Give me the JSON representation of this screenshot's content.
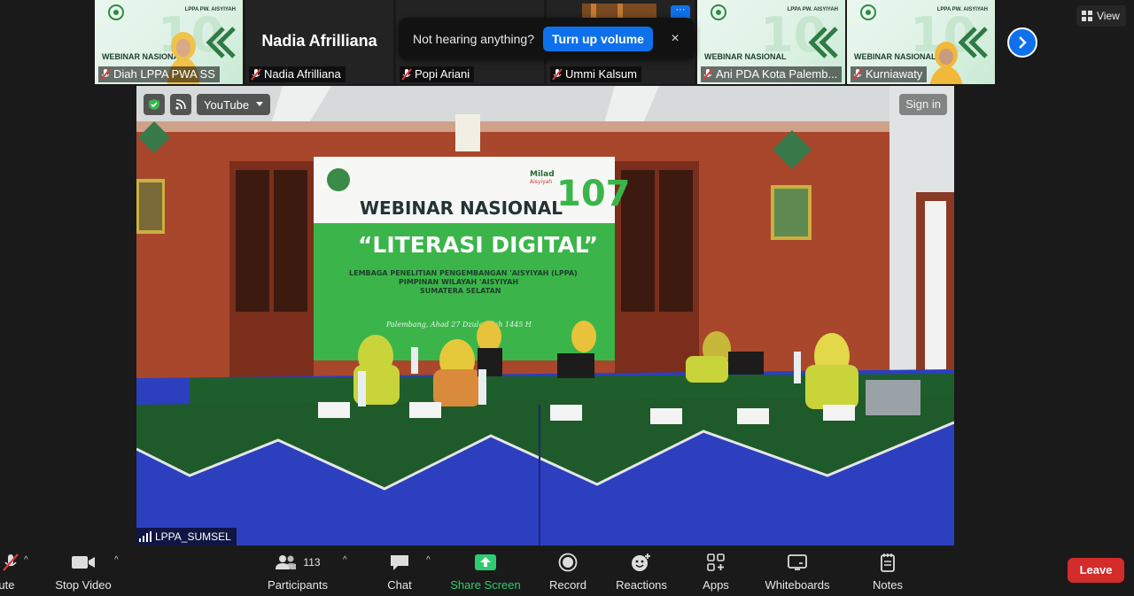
{
  "top_strip": {
    "tiles": [
      {
        "name": "Diah LPPA PWA SS",
        "muted": true,
        "poster_title": "WEBINAR NASIONAL",
        "poster_header": "LPPA PW. AISYIYAH"
      },
      {
        "name": "Nadia Afrilliana",
        "muted": true,
        "big_name": "Nadia Afrilliana"
      },
      {
        "name": "Popi Ariani",
        "muted": true
      },
      {
        "name": "Ummi Kalsum",
        "muted": true
      },
      {
        "name": "Ani PDA Kota Palemb...",
        "muted": true,
        "poster_title": "WEBINAR NASIONAL",
        "poster_header": "LPPA PW. AISYIYAH"
      },
      {
        "name": "Kurniawaty",
        "muted": true,
        "poster_title": "WEBINAR NASIONAL",
        "poster_header": "LPPA PW. AISYIYAH"
      }
    ],
    "notice": {
      "message": "Not hearing anything?",
      "button": "Turn up volume",
      "close": "×"
    },
    "more_dots": "···",
    "view_label": "View"
  },
  "main_video": {
    "source_label": "YouTube",
    "sign_in": "Sign in",
    "camera_name": "LPPA_SUMSEL",
    "banner": {
      "miliad": "Milad",
      "miliad_sub": "Aisyiyah",
      "number": "107",
      "title": "WEBINAR NASIONAL",
      "subtitle": "“LITERASI DIGITAL”",
      "line1": "LEMBAGA PENELITIAN PENGEMBANGAN 'AISYIYAH (LPPA)",
      "line2": "PIMPINAN WILAYAH 'AISYIYAH",
      "line3": "SUMATERA SELATAN",
      "line4": "Palembang, Ahad 27 Dzulqa'dah 1445 H"
    }
  },
  "toolbar": {
    "mute": "Mute",
    "stop_video": "Stop Video",
    "participants": "Participants",
    "participant_count": "113",
    "chat": "Chat",
    "share_screen": "Share Screen",
    "record": "Record",
    "reactions": "Reactions",
    "apps": "Apps",
    "whiteboards": "Whiteboards",
    "notes": "Notes",
    "leave": "Leave"
  },
  "colors": {
    "accent": "#0e71eb",
    "leave": "#d42b2b",
    "share_green": "#2ecc71",
    "banner_green": "#3bb54a"
  }
}
